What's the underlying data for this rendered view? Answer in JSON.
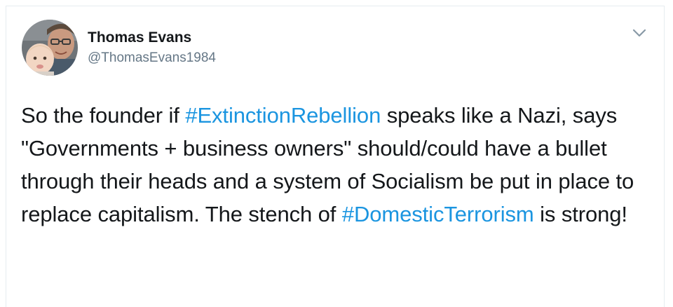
{
  "user": {
    "display_name": "Thomas Evans",
    "handle": "@ThomasEvans1984"
  },
  "tweet": {
    "part1": "So the founder if ",
    "hashtag1": "#ExtinctionRebellion",
    "part2": " speaks like a Nazi, says \"Governments + business owners\" should/could have a bullet through their heads and a system of Socialism be put in place to replace capitalism. The stench of ",
    "hashtag2": "#DomesticTerrorism",
    "part3": " is strong!"
  },
  "icons": {
    "menu": "chevron-down-icon"
  },
  "colors": {
    "hashtag": "#1b95e0",
    "text": "#14171a",
    "handle": "#657786",
    "border": "#e6ecf0"
  }
}
